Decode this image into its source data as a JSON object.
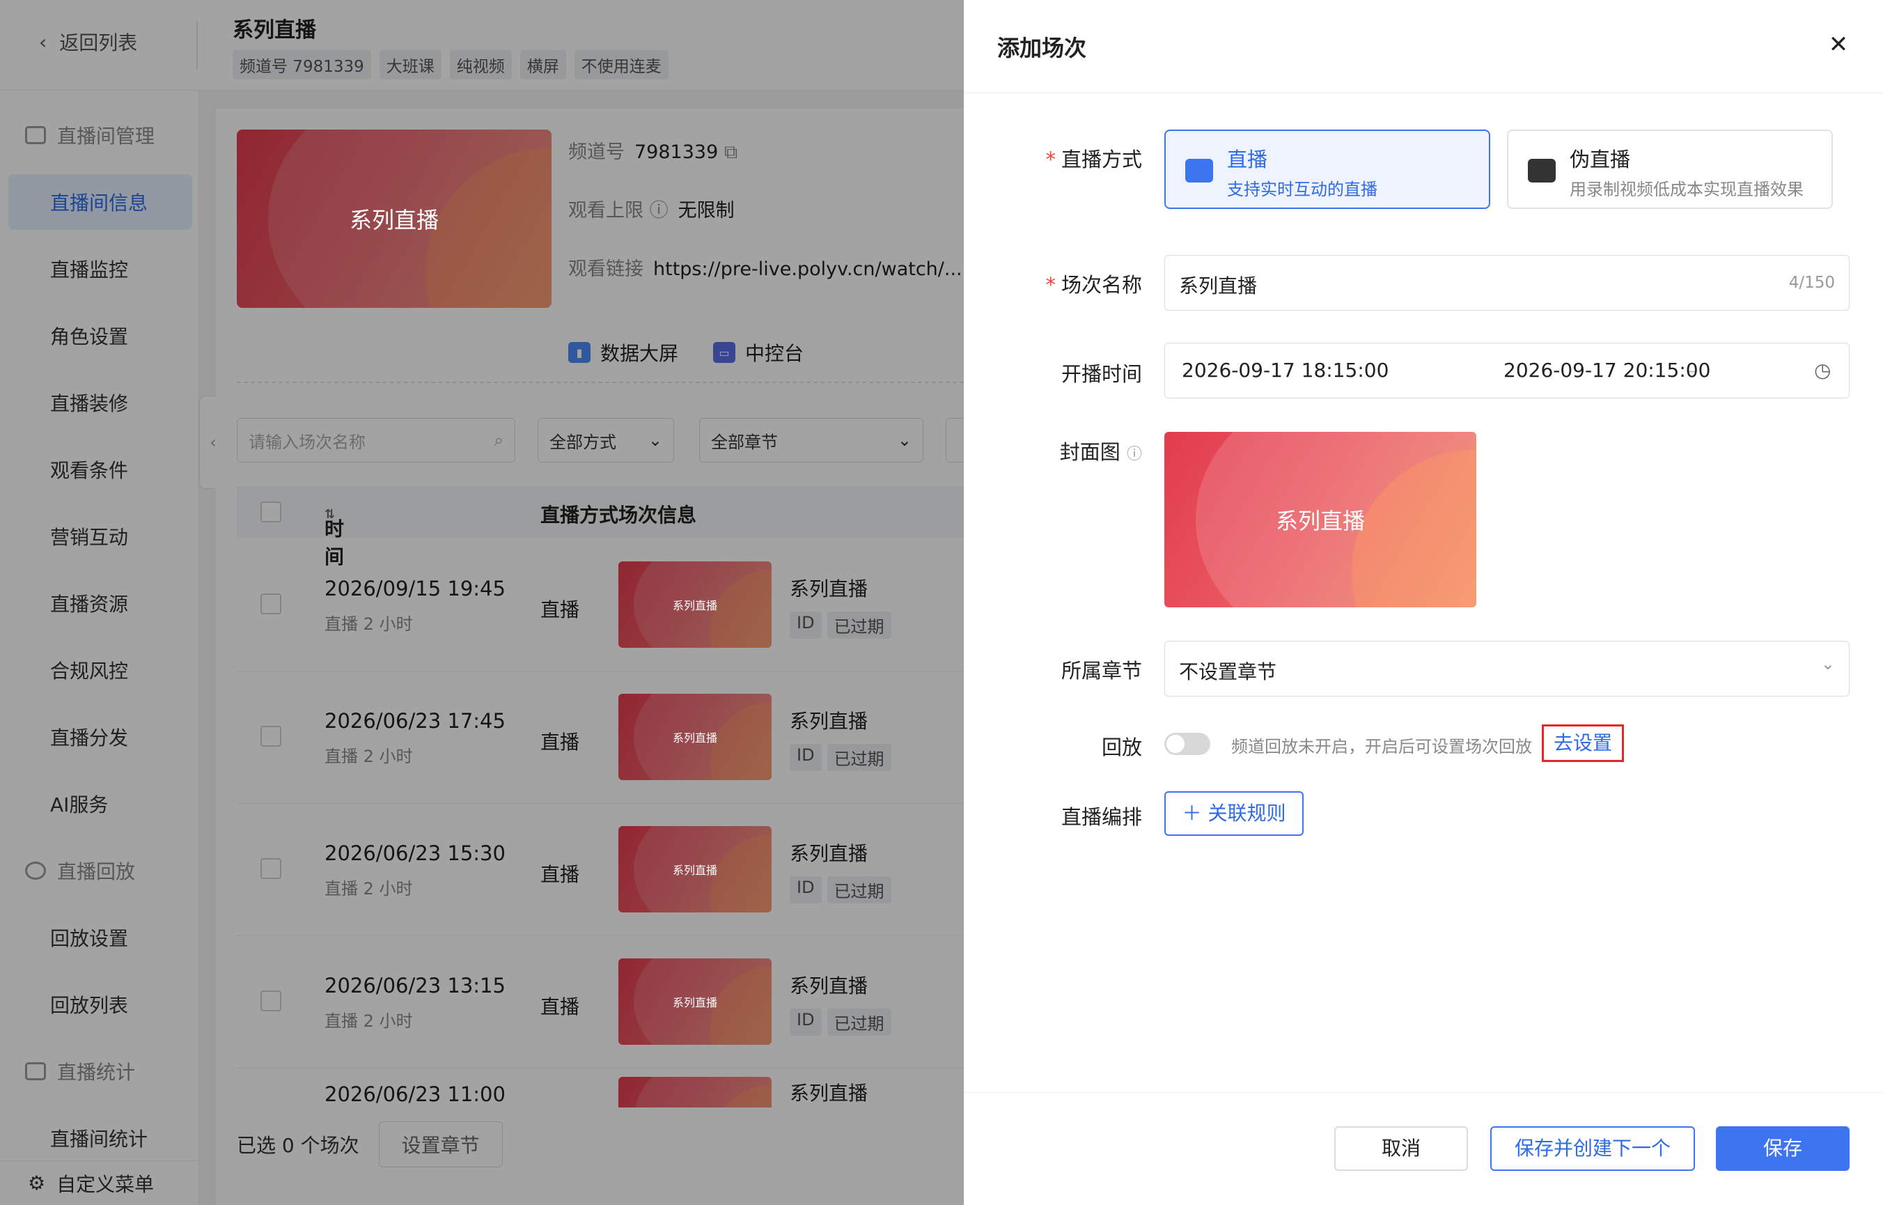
{
  "header": {
    "back_label": "返回列表",
    "title": "系列直播",
    "tags": [
      "频道号 7981339",
      "大班课",
      "纯视频",
      "横屏",
      "不使用连麦"
    ]
  },
  "sidebar": {
    "groups": [
      "直播间管理",
      "直播回放",
      "直播统计"
    ],
    "items": [
      "直播间信息",
      "直播监控",
      "角色设置",
      "直播装修",
      "观看条件",
      "营销互动",
      "直播资源",
      "合规风控",
      "直播分发",
      "AI服务",
      "回放设置",
      "回放列表",
      "直播间统计"
    ],
    "active": "直播间信息",
    "bottom": "自定义菜单"
  },
  "channel": {
    "cover_text": "系列直播",
    "id_label": "频道号",
    "id_value": "7981339",
    "limit_label": "观看上限",
    "limit_value": "无限制",
    "link_label": "观看链接",
    "link_value": "https://pre-live.polyv.cn/watch/...",
    "quick": [
      "数据大屏",
      "中控台"
    ]
  },
  "filters": {
    "search_placeholder": "请输入场次名称",
    "mode": "全部方式",
    "chapter": "全部章节"
  },
  "table": {
    "headers": [
      "时间",
      "直播方式",
      "场次信息"
    ],
    "rows": [
      {
        "time": "2026/09/15 19:45",
        "duration": "直播 2 小时",
        "mode": "直播",
        "name": "系列直播",
        "tag1": "ID",
        "tag2": "已过期"
      },
      {
        "time": "2026/06/23 17:45",
        "duration": "直播 2 小时",
        "mode": "直播",
        "name": "系列直播",
        "tag1": "ID",
        "tag2": "已过期"
      },
      {
        "time": "2026/06/23 15:30",
        "duration": "直播 2 小时",
        "mode": "直播",
        "name": "系列直播",
        "tag1": "ID",
        "tag2": "已过期"
      },
      {
        "time": "2026/06/23 13:15",
        "duration": "直播 2 小时",
        "mode": "直播",
        "name": "系列直播",
        "tag1": "ID",
        "tag2": "已过期"
      },
      {
        "time": "2026/06/23 11:00",
        "duration": "",
        "mode": "",
        "name": "系列直播",
        "tag1": "",
        "tag2": ""
      }
    ],
    "thumb_text": "系列直播"
  },
  "list_footer": {
    "selected": "已选 0 个场次",
    "set_chapter": "设置章节"
  },
  "drawer": {
    "title": "添加场次",
    "mode_label": "直播方式",
    "mode_live_title": "直播",
    "mode_live_desc": "支持实时互动的直播",
    "mode_pseudo_title": "伪直播",
    "mode_pseudo_desc": "用录制视频低成本实现直播效果",
    "name_label": "场次名称",
    "name_value": "系列直播",
    "name_count": "4/150",
    "time_label": "开播时间",
    "time_start": "2026-09-17 18:15:00",
    "time_sep": "–",
    "time_end": "2026-09-17 20:15:00",
    "cover_label": "封面图",
    "cover_text": "系列直播",
    "chapter_label": "所属章节",
    "chapter_value": "不设置章节",
    "replay_label": "回放",
    "replay_hint": "频道回放未开启，开启后可设置场次回放",
    "replay_link": "去设置",
    "schedule_label": "直播编排",
    "schedule_button": "＋ 关联规则",
    "cancel": "取消",
    "save_next": "保存并创建下一个",
    "save": "保存"
  },
  "colors": {
    "accent": "#3d74f0",
    "required": "#f0463c",
    "highlight_border": "#e02a2a"
  }
}
